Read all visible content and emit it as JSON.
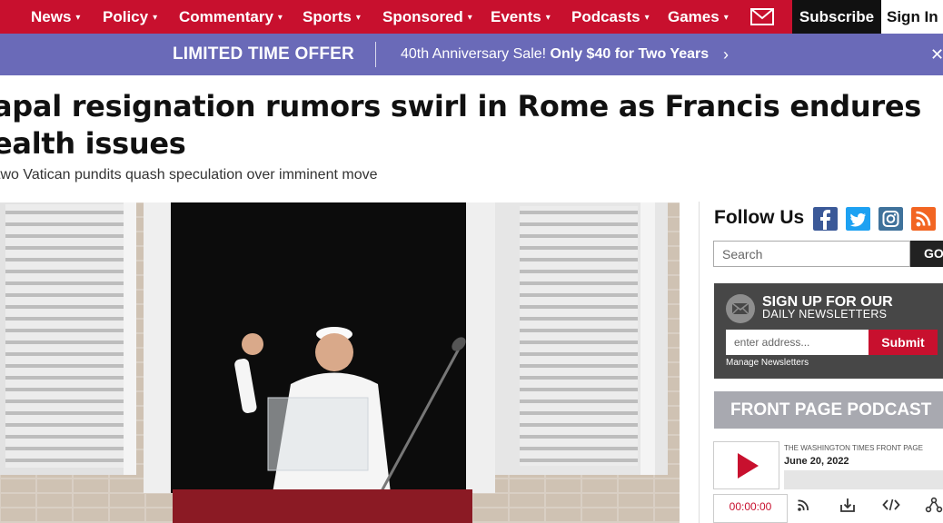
{
  "nav": {
    "items": [
      {
        "label": "News"
      },
      {
        "label": "Policy"
      },
      {
        "label": "Commentary"
      },
      {
        "label": "Sports"
      },
      {
        "label": "Sponsored"
      },
      {
        "label": "Events"
      },
      {
        "label": "Podcasts"
      },
      {
        "label": "Games"
      }
    ],
    "caret": "▾",
    "subscribe_label": "Subscribe",
    "signin_label": "Sign In",
    "mail_icon": "mail-icon",
    "color": "#c8102e"
  },
  "promo": {
    "title": "LIMITED TIME OFFER",
    "text_lead": "40th Anniversary Sale!",
    "text_bold": "Only $40 for Two Years",
    "chevron": "›",
    "close": "✕",
    "color": "#6a6ab8"
  },
  "article": {
    "headline": "apal resignation rumors swirl in Rome as Francis endures ealth issues",
    "headline_line1": "apal resignation rumors swirl in Rome as Francis endures",
    "headline_line2": "ealth issues",
    "subhead": "two Vatican pundits quash speculation over imminent move"
  },
  "sidebar": {
    "follow_label": "Follow Us",
    "social_icons": [
      "facebook-icon",
      "twitter-icon",
      "instagram-icon",
      "rss-icon"
    ],
    "search": {
      "placeholder": "Search",
      "button": "GO"
    },
    "newsletter": {
      "title": "SIGN UP FOR OUR",
      "subtitle": "DAILY NEWSLETTERS",
      "placeholder": "enter address...",
      "submit": "Submit",
      "manage": "Manage Newsletters"
    },
    "podcast": {
      "header": "FRONT PAGE PODCAST",
      "show": "THE WASHINGTON TIMES FRONT PAGE",
      "date": "June 20, 2022",
      "time": "00:00:00"
    }
  }
}
